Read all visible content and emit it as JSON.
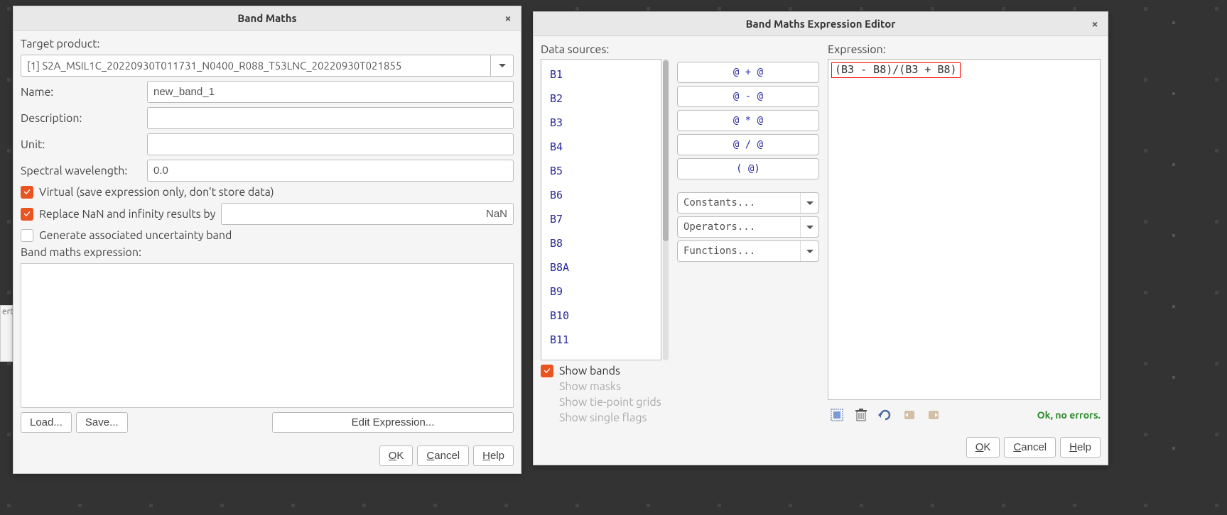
{
  "left_dialog": {
    "title": "Band Maths",
    "target_label": "Target product:",
    "target_value": "[1] S2A_MSIL1C_20220930T011731_N0400_R088_T53LNC_20220930T021855",
    "name_label": "Name:",
    "name_value": "new_band_1",
    "desc_label": "Description:",
    "desc_value": "",
    "unit_label": "Unit:",
    "unit_value": "",
    "wavelength_label": "Spectral wavelength:",
    "wavelength_value": "0.0",
    "virtual_label": "Virtual (save expression only, don't store data)",
    "replace_nan_label": "Replace NaN and infinity results by",
    "replace_nan_value": "NaN",
    "uncertainty_label": "Generate associated uncertainty band",
    "expr_label": "Band maths expression:",
    "load_btn": "Load...",
    "save_btn": "Save...",
    "edit_expr_btn": "Edit Expression...",
    "ok_btn": "OK",
    "cancel_btn": "Cancel",
    "help_btn": "Help"
  },
  "right_dialog": {
    "title": "Band Maths Expression Editor",
    "sources_label": "Data sources:",
    "sources": [
      "B1",
      "B2",
      "B3",
      "B4",
      "B5",
      "B6",
      "B7",
      "B8",
      "B8A",
      "B9",
      "B10",
      "B11"
    ],
    "ops": [
      "@ + @",
      "@ - @",
      "@ * @",
      "@ / @",
      "( @)"
    ],
    "constants_label": "Constants...",
    "operators_label": "Operators...",
    "functions_label": "Functions...",
    "expr_label": "Expression:",
    "expr_value": "(B3 - B8)/(B3 + B8)",
    "show_bands_label": "Show bands",
    "show_masks_label": "Show masks",
    "show_tiepoints_label": "Show tie-point grids",
    "show_flags_label": "Show single flags",
    "status": "Ok, no errors.",
    "ok_btn": "OK",
    "cancel_btn": "Cancel",
    "help_btn": "Help"
  },
  "stub_text": "ert"
}
